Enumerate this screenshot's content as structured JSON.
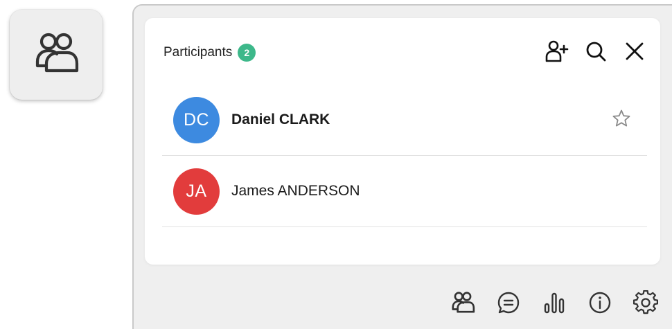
{
  "toggle": {
    "icon": "people-icon"
  },
  "panel": {
    "title": "Participants",
    "count": "2",
    "badge_color": "#3db88a",
    "actions": [
      {
        "name": "add-participant",
        "icon": "add-user-icon"
      },
      {
        "name": "search",
        "icon": "search-icon"
      },
      {
        "name": "close",
        "icon": "close-icon"
      }
    ]
  },
  "participants": [
    {
      "initials": "DC",
      "name": "Daniel CLARK",
      "avatar_color": "#3d8ae0",
      "bold": true,
      "star": true
    },
    {
      "initials": "JA",
      "name": "James ANDERSON",
      "avatar_color": "#e23c3c",
      "bold": false,
      "star": false
    }
  ],
  "footer": {
    "icons": [
      "people-icon",
      "chat-icon",
      "bar-chart-icon",
      "info-icon",
      "gear-icon"
    ]
  }
}
